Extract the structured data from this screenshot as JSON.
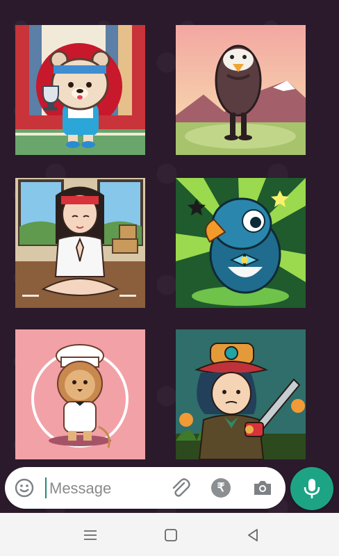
{
  "stickers": [
    {
      "id": "bear-trophy",
      "icon": "bear-holding-trophy-icon"
    },
    {
      "id": "penguin-mountains",
      "icon": "penguin-icon"
    },
    {
      "id": "girl-meditating",
      "icon": "meditating-girl-icon"
    },
    {
      "id": "parrot-bowtie",
      "icon": "parrot-bowtie-icon"
    },
    {
      "id": "lion-chef",
      "icon": "lion-chef-icon"
    },
    {
      "id": "boy-chainsaw",
      "icon": "boy-chainsaw-icon"
    }
  ],
  "composer": {
    "placeholder": "Message",
    "rupee_symbol": "₹"
  },
  "colors": {
    "accent": "#1da485",
    "chat_background": "#2a1a2b",
    "navbar": "#f4f4f4"
  }
}
